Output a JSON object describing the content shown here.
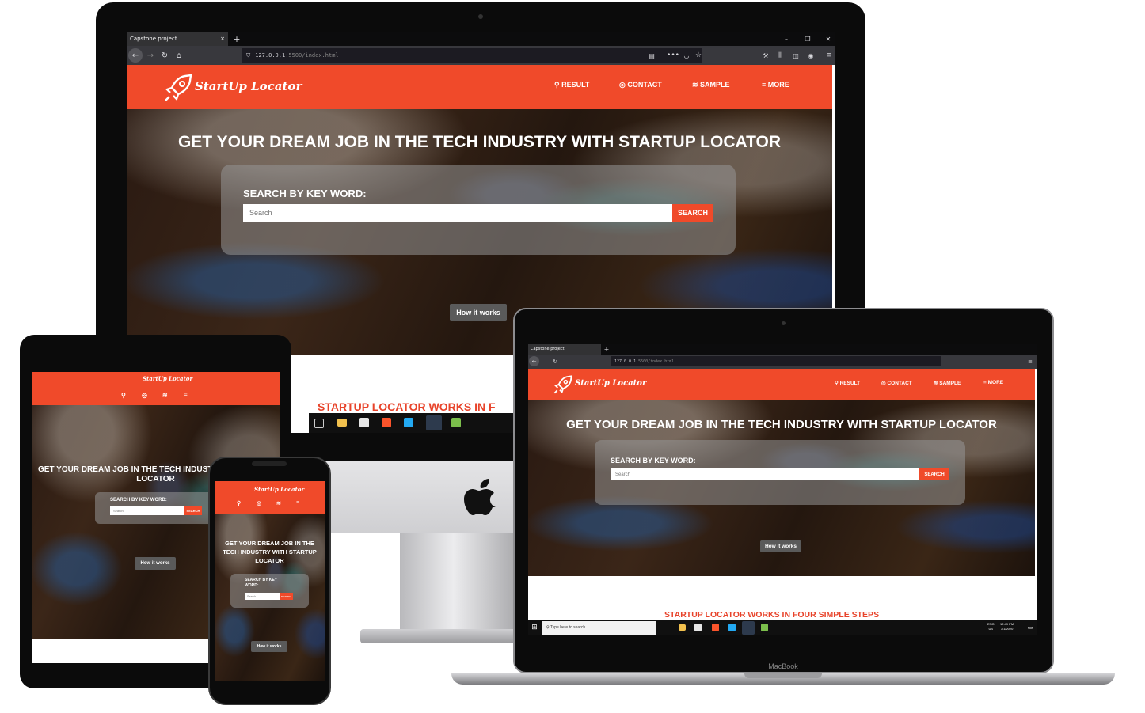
{
  "browser": {
    "tab_title": "Capstone project",
    "url_host": "127.0.0.1",
    "url_rest": ":5500/index.html",
    "new_tab": "+",
    "close_tab": "×",
    "win_min": "–",
    "win_max": "❐",
    "win_close": "✕"
  },
  "site": {
    "logo": "StartUp Locator",
    "nav": {
      "result": "RESULT",
      "contact": "CONTACT",
      "sample": "SAMPLE",
      "more": "MORE"
    },
    "hero_title": "GET YOUR DREAM JOB IN THE TECH INDUSTRY WITH STARTUP LOCATOR",
    "hero_title_tablet_1": "GET YOUR DREAM JOB IN THE TECH INDUSTR",
    "hero_title_tablet_2": "LOCATOR",
    "hero_title_phone_1": "GET YOUR DREAM JOB IN THE",
    "hero_title_phone_2": "TECH INDUSTRY WITH STARTUP",
    "hero_title_phone_3": "LOCATOR",
    "search_label": "SEARCH BY KEY WORD:",
    "search_label_phone_1": "SEARCH BY KEY",
    "search_label_phone_2": "WORD:",
    "search_placeholder": "Search",
    "search_button": "SEARCH",
    "how_it_works": "How it works",
    "steps_title": "STARTUP LOCATOR WORKS IN FOUR SIMPLE STEPS",
    "steps_title_partial": "STARTUP LOCATOR WORKS IN F"
  },
  "windows": {
    "search_placeholder": "Type here to search",
    "lang_1": "ENG",
    "lang_2": "US",
    "time": "12:49 PM",
    "date": "7/1/2020"
  },
  "devices": {
    "laptop_brand": "MacBook"
  },
  "colors": {
    "brand": "#f04a2a",
    "steps_title": "#e8432a"
  },
  "icons": [
    "rocket-icon",
    "search-icon",
    "contact-icon",
    "wifi-icon",
    "menu-icon",
    "apple-logo-icon",
    "back-icon",
    "forward-icon",
    "reload-icon",
    "home-icon",
    "shield-icon",
    "reader-icon",
    "pocket-icon",
    "star-icon",
    "library-icon",
    "sidebar-icon",
    "account-icon",
    "hamburger-icon"
  ]
}
